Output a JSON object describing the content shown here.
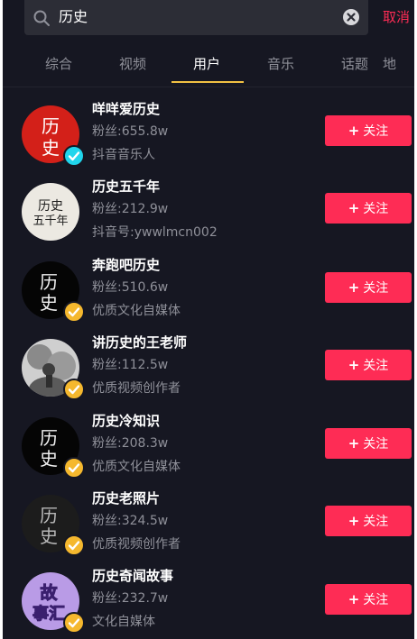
{
  "search": {
    "query": "历史",
    "cancel_label": "取消"
  },
  "tabs": [
    {
      "label": "综合",
      "active": false
    },
    {
      "label": "视频",
      "active": false
    },
    {
      "label": "用户",
      "active": true
    },
    {
      "label": "音乐",
      "active": false
    },
    {
      "label": "话题",
      "active": false
    },
    {
      "label": "地",
      "active": false
    }
  ],
  "follow_label": "关注",
  "users": [
    {
      "name": "咩咩爱历史",
      "fans": "粉丝:655.8w",
      "desc": "抖音音乐人",
      "verified": "blue",
      "avatar_text": [
        "历",
        "史"
      ],
      "avatar_style": "red"
    },
    {
      "name": "历史五千年",
      "fans": "粉丝:212.9w",
      "desc": "抖音号:ywwlmcn002",
      "verified": "none",
      "avatar_text": [
        "历史",
        "五千年"
      ],
      "avatar_style": "paper"
    },
    {
      "name": "奔跑吧历史",
      "fans": "粉丝:510.6w",
      "desc": "优质文化自媒体",
      "verified": "yellow",
      "avatar_text": [
        "历",
        "史"
      ],
      "avatar_style": "black"
    },
    {
      "name": "讲历史的王老师",
      "fans": "粉丝:112.5w",
      "desc": "优质视频创作者",
      "verified": "yellow",
      "avatar_text": [
        "",
        ""
      ],
      "avatar_style": "photo"
    },
    {
      "name": "历史冷知识",
      "fans": "粉丝:208.3w",
      "desc": "优质文化自媒体",
      "verified": "yellow",
      "avatar_text": [
        "历",
        "史"
      ],
      "avatar_style": "black"
    },
    {
      "name": "历史老照片",
      "fans": "粉丝:324.5w",
      "desc": "优质视频创作者",
      "verified": "yellow",
      "avatar_text": [
        "历",
        "史"
      ],
      "avatar_style": "dark"
    },
    {
      "name": "历史奇闻故事",
      "fans": "粉丝:232.7w",
      "desc": "文化自媒体",
      "verified": "yellow",
      "avatar_text": [
        "故",
        "事汇"
      ],
      "avatar_style": "purple"
    }
  ],
  "colors": {
    "background": "#161722",
    "accent": "#fe2c55",
    "tab_underline": "#f2c143",
    "verified_blue": "#20d5ec",
    "verified_yellow": "#f5b82e"
  }
}
